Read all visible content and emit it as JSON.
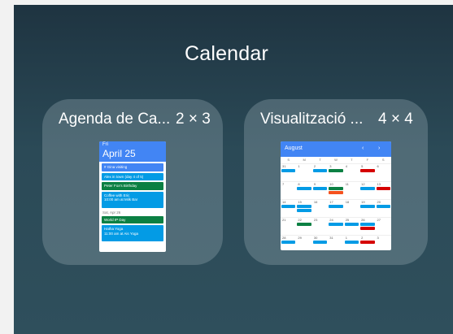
{
  "title": "Calendar",
  "widgets": [
    {
      "name": "Agenda de Ca...",
      "size": "2 × 3",
      "preview": {
        "day": "Fri",
        "date": "April 25",
        "events": [
          {
            "text": "# Gina visiting",
            "color": "#4285f4"
          },
          {
            "text": "Alex in town (day 4 of 5)",
            "color": "#039be5"
          },
          {
            "text": "Peter Fox's Birthday",
            "color": "#0b8043"
          },
          {
            "text": "Coffee with Eric",
            "sub": "10:00 am at Milk Bar",
            "color": "#039be5"
          }
        ],
        "separator": "Sat, Apr 26",
        "events2": [
          {
            "text": "World IP Day",
            "color": "#0b8043"
          },
          {
            "text": "Hatha Yoga",
            "sub": "11:00 am at Ais Yoga",
            "color": "#039be5"
          }
        ]
      }
    },
    {
      "name": "Visualització ...",
      "size": "4 × 4",
      "preview": {
        "month": "August",
        "prev": "‹",
        "next": "›",
        "dow": [
          "S",
          "M",
          "T",
          "W",
          "T",
          "F",
          "S"
        ],
        "weeks": [
          [
            "31",
            "1",
            "2",
            "3",
            "4",
            "5",
            "6"
          ],
          [
            "7",
            "8",
            "9",
            "10",
            "11",
            "12",
            "13"
          ],
          [
            "14",
            "15",
            "16",
            "17",
            "18",
            "19",
            "20"
          ],
          [
            "21",
            "22",
            "23",
            "24",
            "25",
            "26",
            "27"
          ],
          [
            "28",
            "29",
            "30",
            "31",
            "1",
            "2",
            "3"
          ]
        ]
      }
    }
  ],
  "colors": {
    "accent": "#4285f4",
    "event_blue": "#039be5",
    "event_green": "#0b8043",
    "event_red": "#d50000",
    "event_orange": "#f4511e"
  }
}
